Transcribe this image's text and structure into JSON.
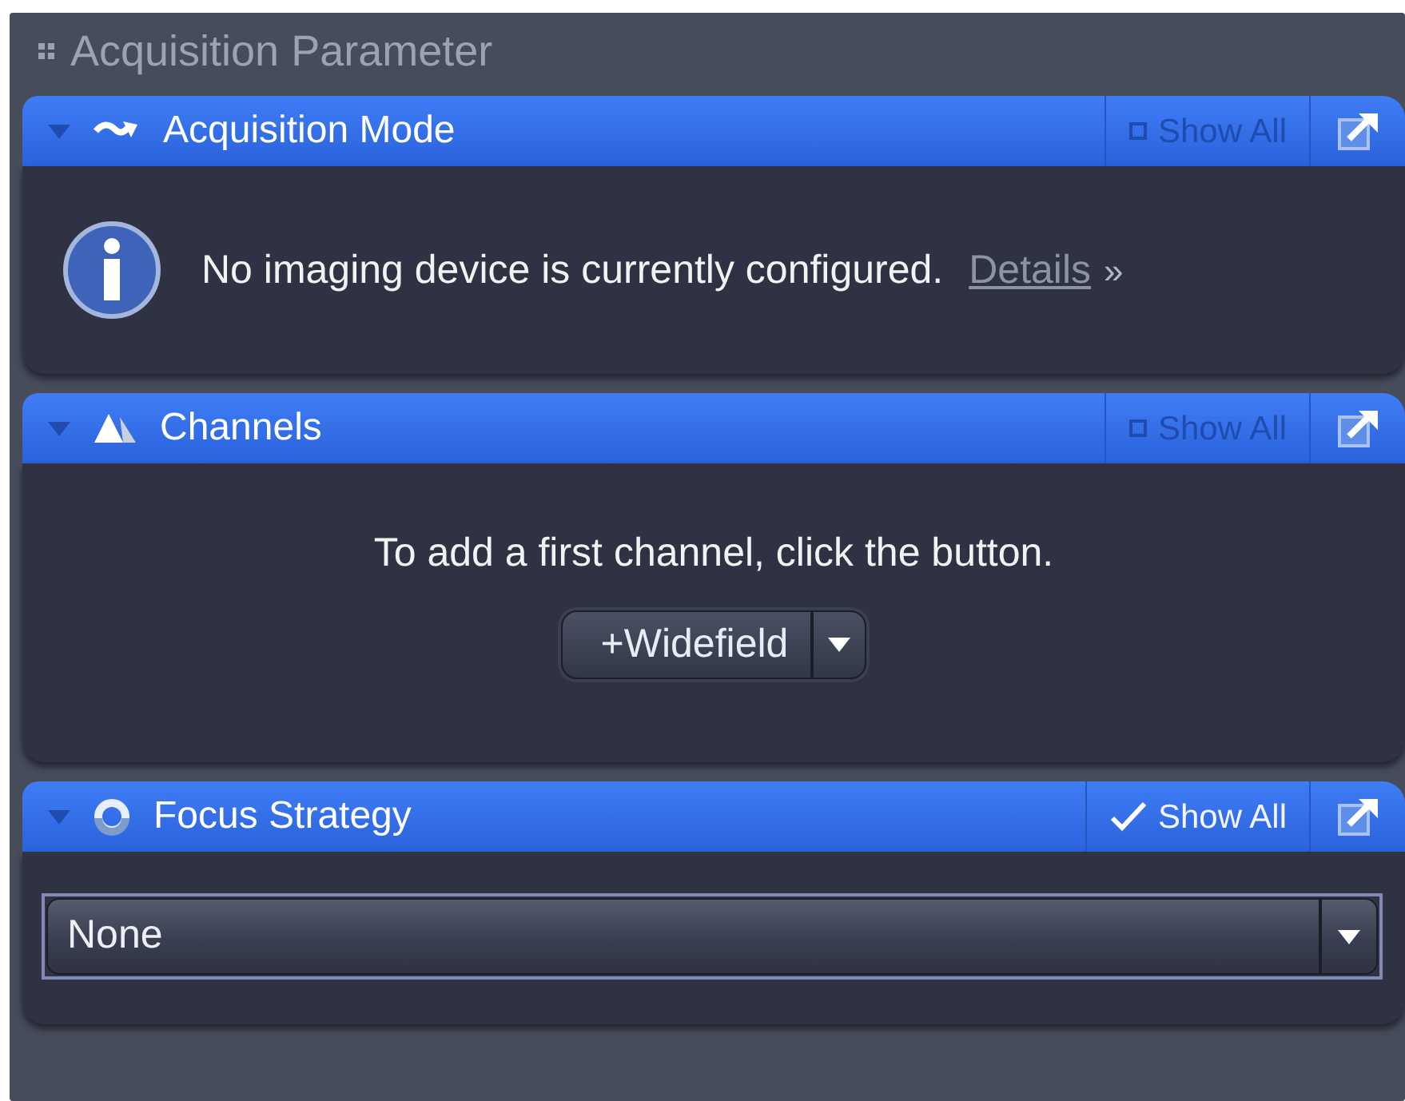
{
  "panel": {
    "title": "Acquisition Parameter"
  },
  "sections": [
    {
      "title": "Acquisition Mode",
      "expanded": true,
      "show_all": {
        "label": "Show All",
        "checked": false
      },
      "kind": "message",
      "message": "No imaging device is currently configured.",
      "link": "Details",
      "link_suffix": "»"
    },
    {
      "title": "Channels",
      "expanded": true,
      "show_all": {
        "label": "Show All",
        "checked": false
      },
      "kind": "add-channel",
      "message": "To add a first channel, click the button.",
      "button": "+Widefield"
    },
    {
      "title": "Focus Strategy",
      "expanded": true,
      "show_all": {
        "label": "Show All",
        "checked": true
      },
      "kind": "dropdown",
      "value": "None"
    }
  ]
}
